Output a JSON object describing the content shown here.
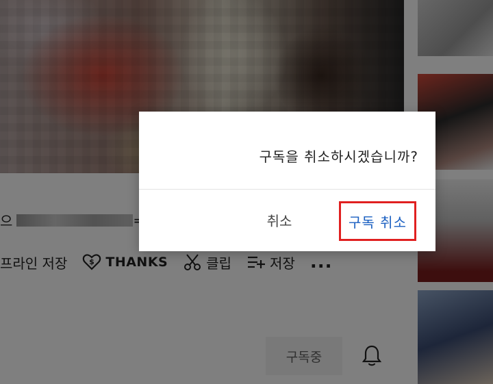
{
  "background": {
    "title_prefix": "으",
    "title_suffix": "=| =",
    "actions": {
      "offline_save": "프라인 저장",
      "thanks": "THANKS",
      "clip": "클립",
      "save": "저장",
      "more": "..."
    },
    "subscribed_label": "구독중"
  },
  "dialog": {
    "message": "구독을 취소하시겠습니까?",
    "cancel_label": "취소",
    "confirm_label": "구독 취소"
  },
  "colors": {
    "confirm_text": "#1a5fc1",
    "highlight_border": "#e02020",
    "overlay": "rgba(0,0,0,0.5)"
  }
}
